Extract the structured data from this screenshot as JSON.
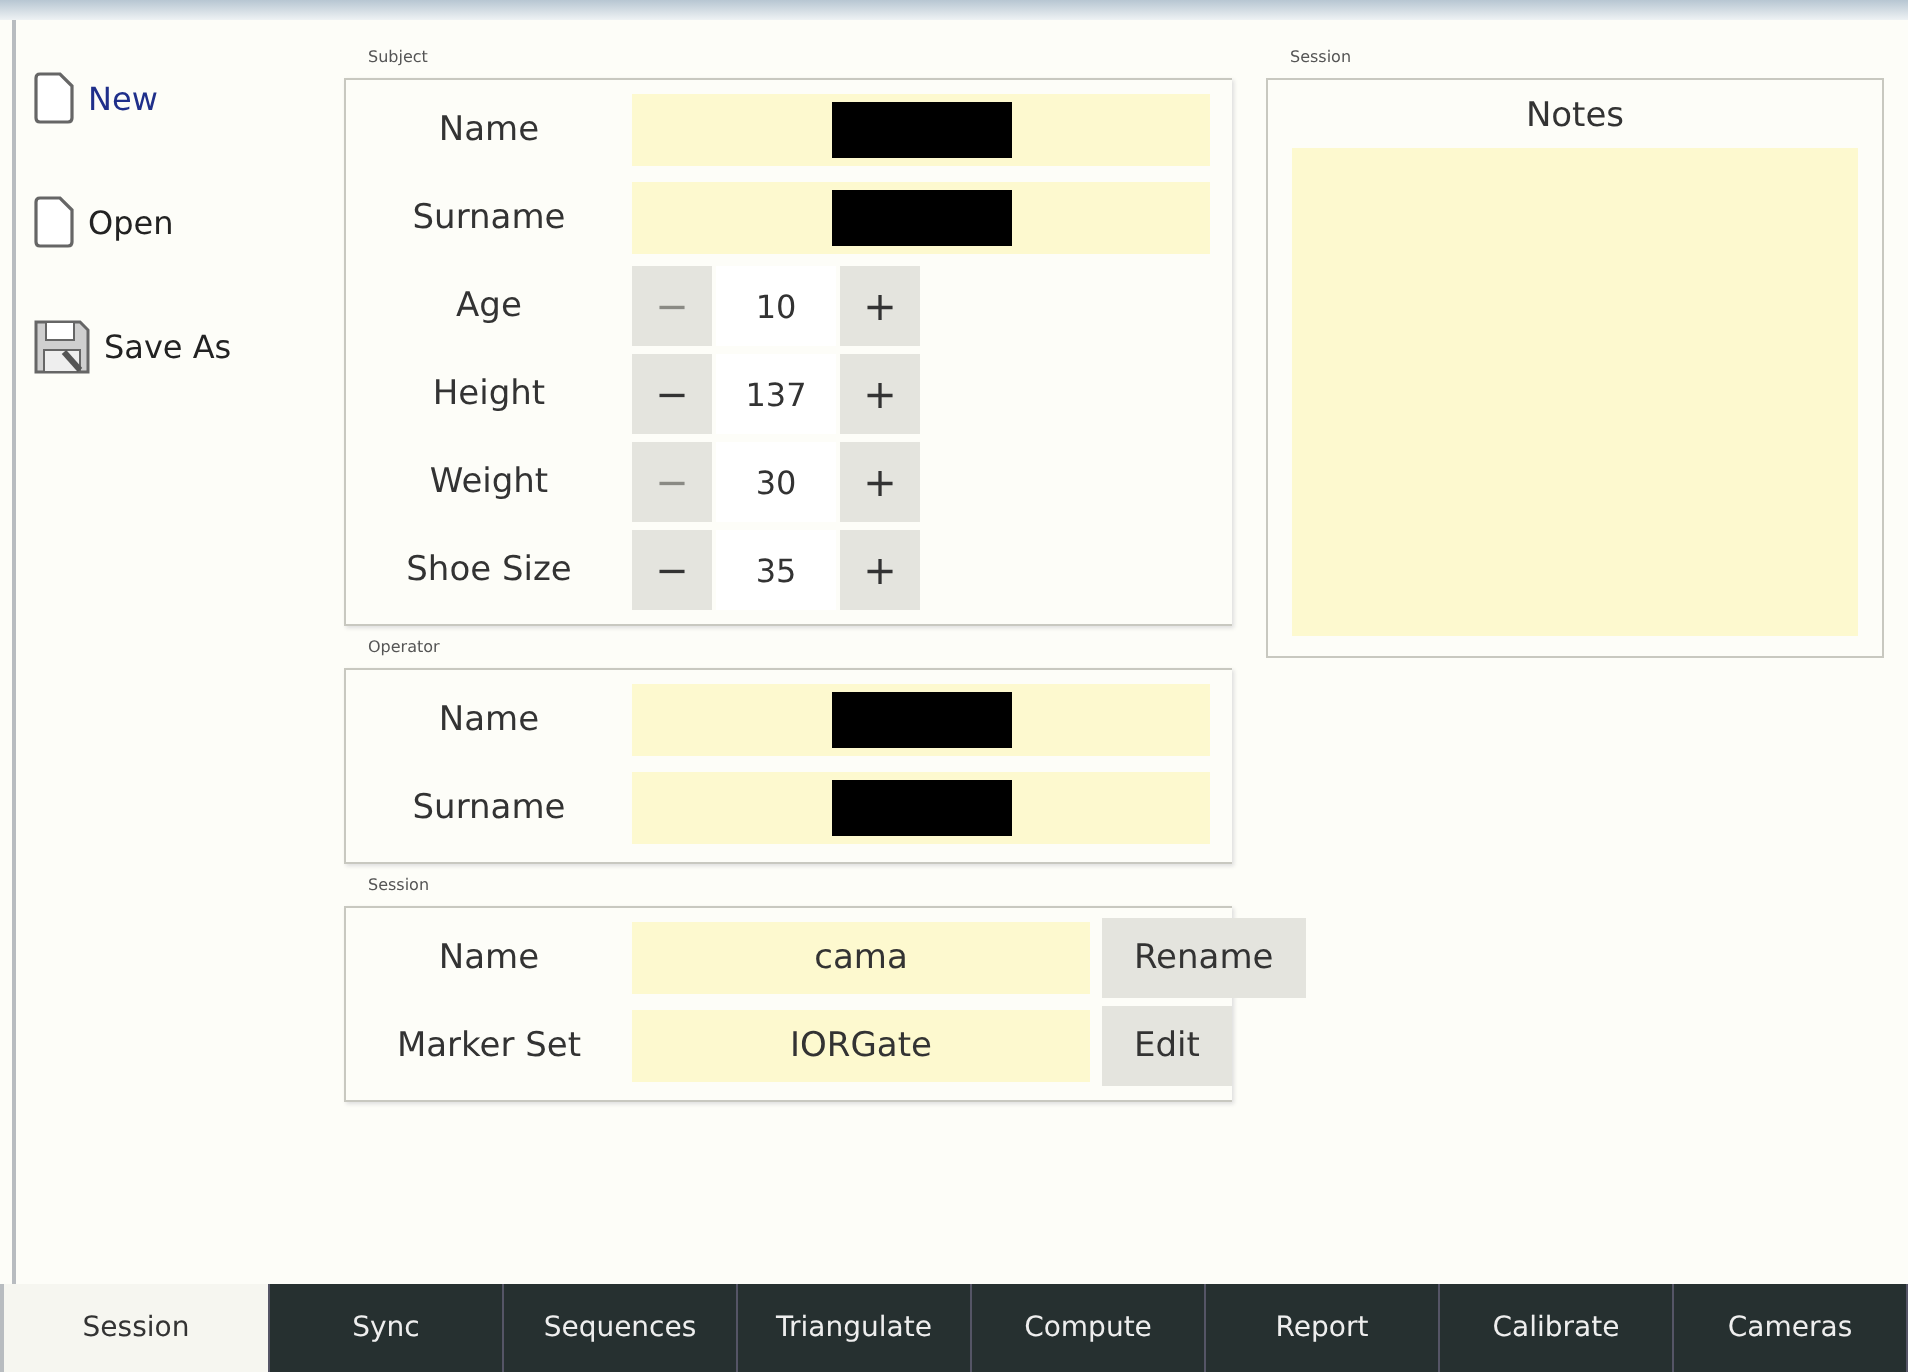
{
  "sidebar": {
    "items": [
      {
        "kind": "page",
        "label": "New",
        "highlighted": true
      },
      {
        "kind": "page",
        "label": "Open",
        "highlighted": false
      },
      {
        "kind": "disk",
        "label": "Save As",
        "highlighted": false
      }
    ]
  },
  "subject": {
    "title": "Subject",
    "rows": [
      {
        "kind": "text",
        "label": "Name",
        "redacted": true
      },
      {
        "kind": "text",
        "label": "Surname",
        "redacted": true
      },
      {
        "kind": "spin",
        "label": "Age",
        "value": "10",
        "minus": "−",
        "plus": "+",
        "minus_disabled": true
      },
      {
        "kind": "spin",
        "label": "Height",
        "value": "137",
        "minus": "−",
        "plus": "+",
        "minus_disabled": false
      },
      {
        "kind": "spin",
        "label": "Weight",
        "value": "30",
        "minus": "−",
        "plus": "+",
        "minus_disabled": true
      },
      {
        "kind": "spin",
        "label": "Shoe Size",
        "value": "35",
        "minus": "−",
        "plus": "+",
        "minus_disabled": false
      }
    ]
  },
  "operator": {
    "title": "Operator",
    "rows": [
      {
        "kind": "text",
        "label": "Name",
        "redacted": true
      },
      {
        "kind": "text",
        "label": "Surname",
        "redacted": true
      }
    ]
  },
  "session": {
    "title": "Session",
    "rows": [
      {
        "kind": "action",
        "label": "Name",
        "value": "cama",
        "button": "Rename"
      },
      {
        "kind": "action",
        "label": "Marker Set",
        "value": "IORGate",
        "button": "Edit"
      }
    ]
  },
  "session_notes": {
    "title": "Session",
    "heading": "Notes"
  },
  "tabs": [
    {
      "label": "Session",
      "selected": true
    },
    {
      "label": "Sync",
      "selected": false
    },
    {
      "label": "Sequences",
      "selected": false
    },
    {
      "label": "Triangulate",
      "selected": false
    },
    {
      "label": "Compute",
      "selected": false
    },
    {
      "label": "Report",
      "selected": false
    },
    {
      "label": "Calibrate",
      "selected": false
    },
    {
      "label": "Cameras",
      "selected": false
    }
  ]
}
